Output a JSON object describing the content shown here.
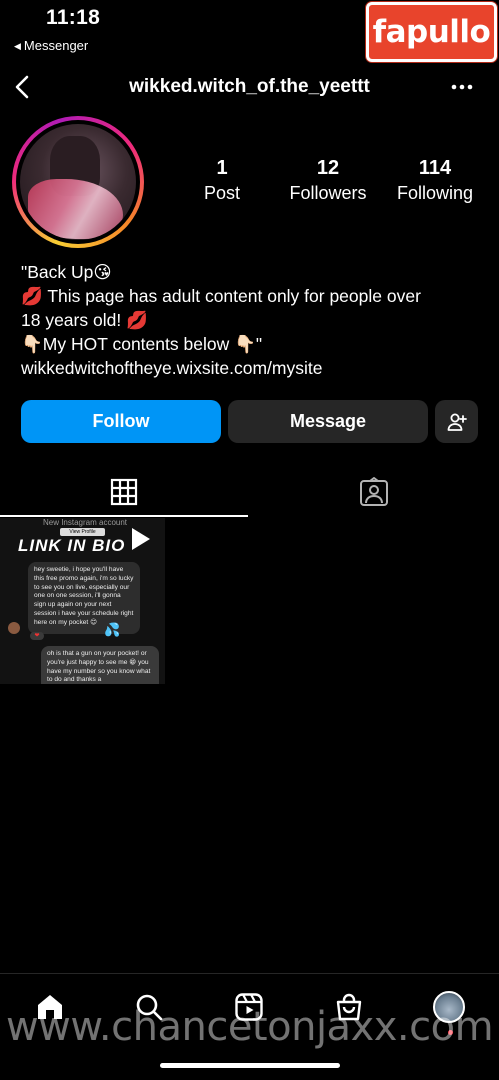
{
  "status_bar": {
    "time": "11:18",
    "back_app": "Messenger"
  },
  "watermark": {
    "brand": "fapullo",
    "url": "www.chancetonjaxx.com"
  },
  "header": {
    "username": "wikked.witch_of.the_yeettt",
    "back_icon": "chevron-left-icon",
    "more_icon": "more-horizontal-icon"
  },
  "profile": {
    "stats": [
      {
        "value": "1",
        "label": "Post"
      },
      {
        "value": "12",
        "label": "Followers"
      },
      {
        "value": "114",
        "label": "Following"
      }
    ],
    "bio_lines": [
      "\"Back Up😘",
      "💋 This page has adult content only for people over",
      "18 years old! 💋",
      "👇🏻My HOT contents below 👇🏻\"",
      "wikkedwitchoftheye.wixsite.com/mysite"
    ]
  },
  "actions": {
    "follow": "Follow",
    "message": "Message",
    "add_user_icon": "add-person-icon"
  },
  "tabs": [
    {
      "name": "posts-grid",
      "icon": "grid-icon",
      "active": true
    },
    {
      "name": "tagged",
      "icon": "tagged-person-icon",
      "active": false
    }
  ],
  "post": {
    "header_text": "New Instagram account",
    "header_button": "View Profile",
    "title": "LINK IN BIO",
    "message_1": "hey sweetie, i hope you'll have this free promo again, i'm so lucky to see you on live, especially our one on one session, i'll gonna sign up again on your next session i have your schedule right here on my pocket 😊",
    "message_2": "oh is that a gun on your pocket! or you're just happy to see me 😁 you have my number so you know what to do and thanks a",
    "reaction": "❤",
    "drops": "💦"
  },
  "bottom_nav": [
    {
      "name": "home",
      "icon": "home-icon"
    },
    {
      "name": "search",
      "icon": "search-icon"
    },
    {
      "name": "reels",
      "icon": "reels-icon"
    },
    {
      "name": "shop",
      "icon": "shop-icon"
    },
    {
      "name": "profile",
      "icon": "profile-avatar-icon"
    }
  ],
  "colors": {
    "background": "#000000",
    "primary_button": "#0095f6",
    "secondary_button": "#262626",
    "watermark_brand": "#e8442c"
  }
}
